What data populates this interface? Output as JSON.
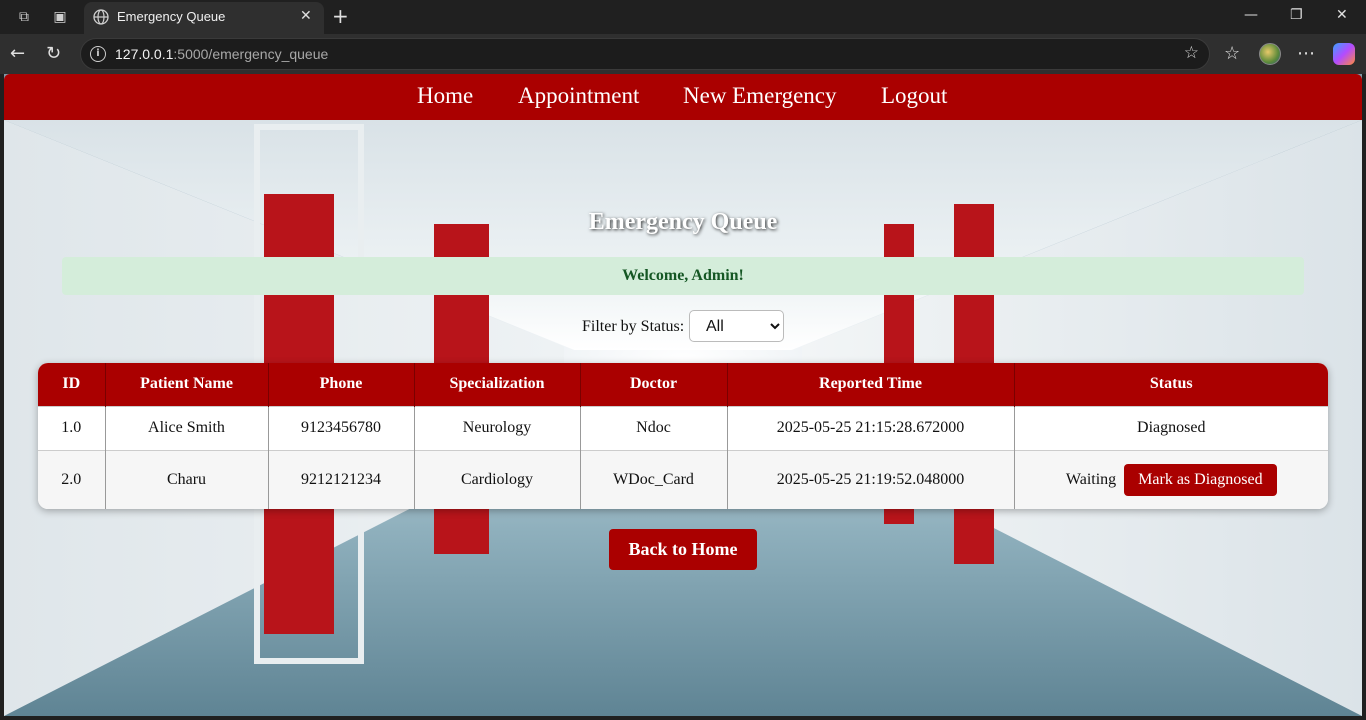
{
  "browser": {
    "tab_title": "Emergency Queue",
    "url_host": "127.0.0.1",
    "url_rest": ":5000/emergency_queue"
  },
  "nav": {
    "home": "Home",
    "appointment": "Appointment",
    "new_emergency": "New Emergency",
    "logout": "Logout"
  },
  "page": {
    "title": "Emergency Queue",
    "flash": "Welcome, Admin!",
    "filter_label": "Filter by Status:",
    "filter_selected": "All",
    "back_label": "Back to Home"
  },
  "table": {
    "headers": [
      "ID",
      "Patient Name",
      "Phone",
      "Specialization",
      "Doctor",
      "Reported Time",
      "Status"
    ],
    "rows": [
      {
        "id": "1.0",
        "name": "Alice Smith",
        "phone": "9123456780",
        "spec": "Neurology",
        "doctor": "Ndoc",
        "time": "2025-05-25 21:15:28.672000",
        "status": "Diagnosed"
      },
      {
        "id": "2.0",
        "name": "Charu",
        "phone": "9212121234",
        "spec": "Cardiology",
        "doctor": "WDoc_Card",
        "time": "2025-05-25 21:19:52.048000",
        "status": "Waiting",
        "action": "Mark as Diagnosed"
      }
    ]
  },
  "colors": {
    "brand_red": "#aa0000",
    "flash_bg": "#d4edda",
    "flash_text": "#155724"
  }
}
